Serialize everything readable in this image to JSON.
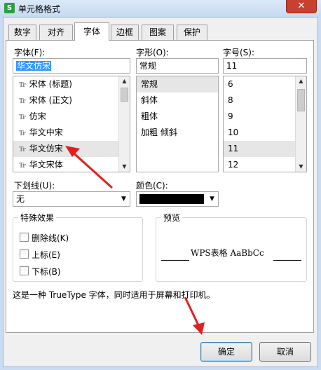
{
  "window": {
    "title": "单元格格式",
    "app_icon": "S",
    "close_glyph": "✕"
  },
  "tabs": [
    {
      "label": "数字"
    },
    {
      "label": "对齐"
    },
    {
      "label": "字体"
    },
    {
      "label": "边框"
    },
    {
      "label": "图案"
    },
    {
      "label": "保护"
    }
  ],
  "active_tab": "字体",
  "font": {
    "label": "字体(F):",
    "value": "华文仿宋",
    "items": [
      {
        "label": "宋体 (标题)",
        "glyph": "Tr"
      },
      {
        "label": "宋体 (正文)",
        "glyph": "Tr"
      },
      {
        "label": "仿宋",
        "glyph": "Tr"
      },
      {
        "label": "华文中宋",
        "glyph": "Tr"
      },
      {
        "label": "华文仿宋",
        "glyph": "Tr"
      },
      {
        "label": "华文宋体",
        "glyph": "Tr"
      }
    ],
    "selected": "华文仿宋"
  },
  "style": {
    "label": "字形(O):",
    "value": "常规",
    "items": [
      "常规",
      "斜体",
      "粗体",
      "加粗 倾斜"
    ],
    "selected": "常规"
  },
  "size": {
    "label": "字号(S):",
    "value": "11",
    "items": [
      "6",
      "8",
      "9",
      "10",
      "11",
      "12"
    ],
    "selected": "11"
  },
  "underline": {
    "label": "下划线(U):",
    "value": "无"
  },
  "color": {
    "label": "颜色(C):",
    "swatch": "#000000"
  },
  "effects": {
    "title": "特殊效果",
    "options": [
      {
        "label": "删除线(K)",
        "checked": false
      },
      {
        "label": "上标(E)",
        "checked": false
      },
      {
        "label": "下标(B)",
        "checked": false
      }
    ]
  },
  "preview": {
    "title": "预览",
    "text": "WPS表格  AaBbCc"
  },
  "description": "这是一种 TrueType 字体，同时适用于屏幕和打印机。",
  "buttons": {
    "ok": "确定",
    "cancel": "取消"
  },
  "annotation_color": "#e02020"
}
